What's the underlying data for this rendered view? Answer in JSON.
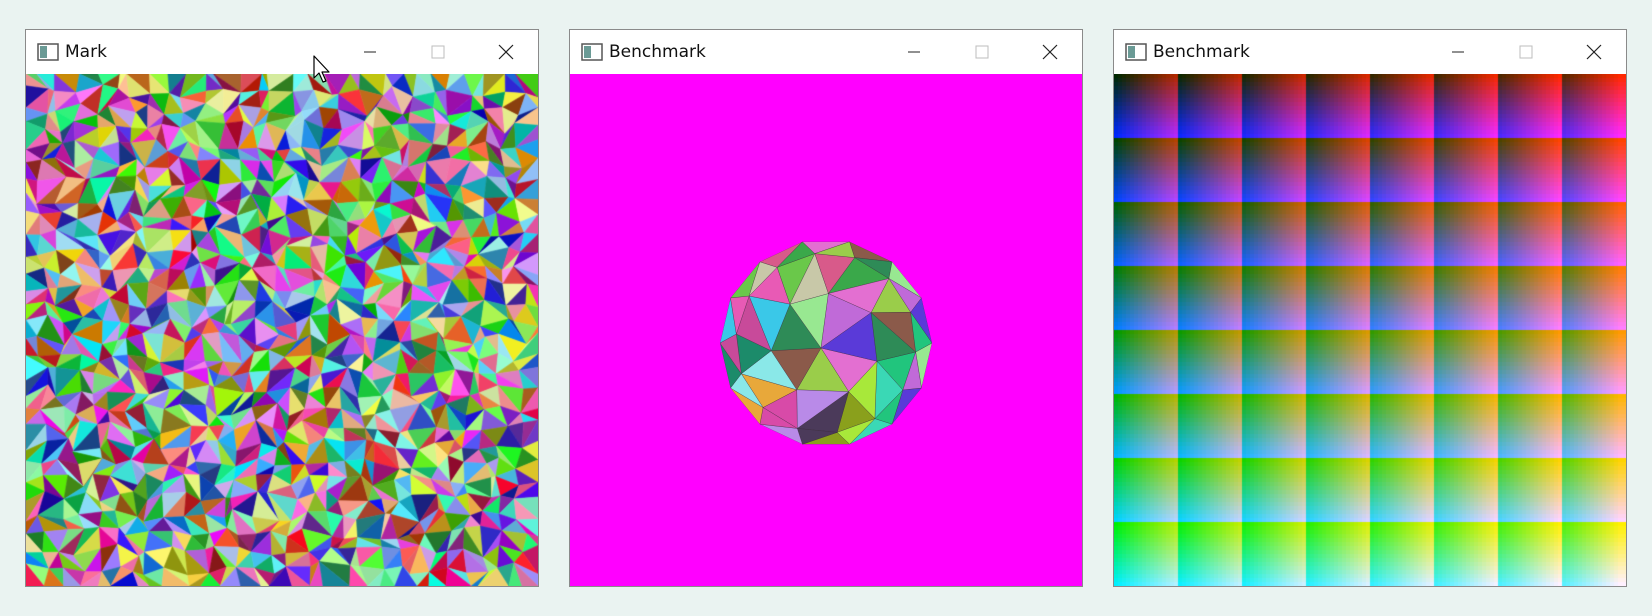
{
  "windows": [
    {
      "title": "Mark",
      "buttons": {
        "minimize": "minimize-icon",
        "maximize": "maximize-icon",
        "close": "close-icon"
      },
      "content": "random colored triangle mosaic"
    },
    {
      "title": "Benchmark",
      "buttons": {
        "minimize": "minimize-icon",
        "maximize": "maximize-icon",
        "close": "close-icon"
      },
      "content": "multicolored polyhedron sphere",
      "background_color": "#ff00ff"
    },
    {
      "title": "Benchmark",
      "buttons": {
        "minimize": "minimize-icon",
        "maximize": "maximize-icon",
        "close": "close-icon"
      },
      "content": "color gradient grid pattern"
    }
  ],
  "desktop": {
    "background_color": "#eaf3f1"
  },
  "cursor": "arrow-cursor-icon"
}
